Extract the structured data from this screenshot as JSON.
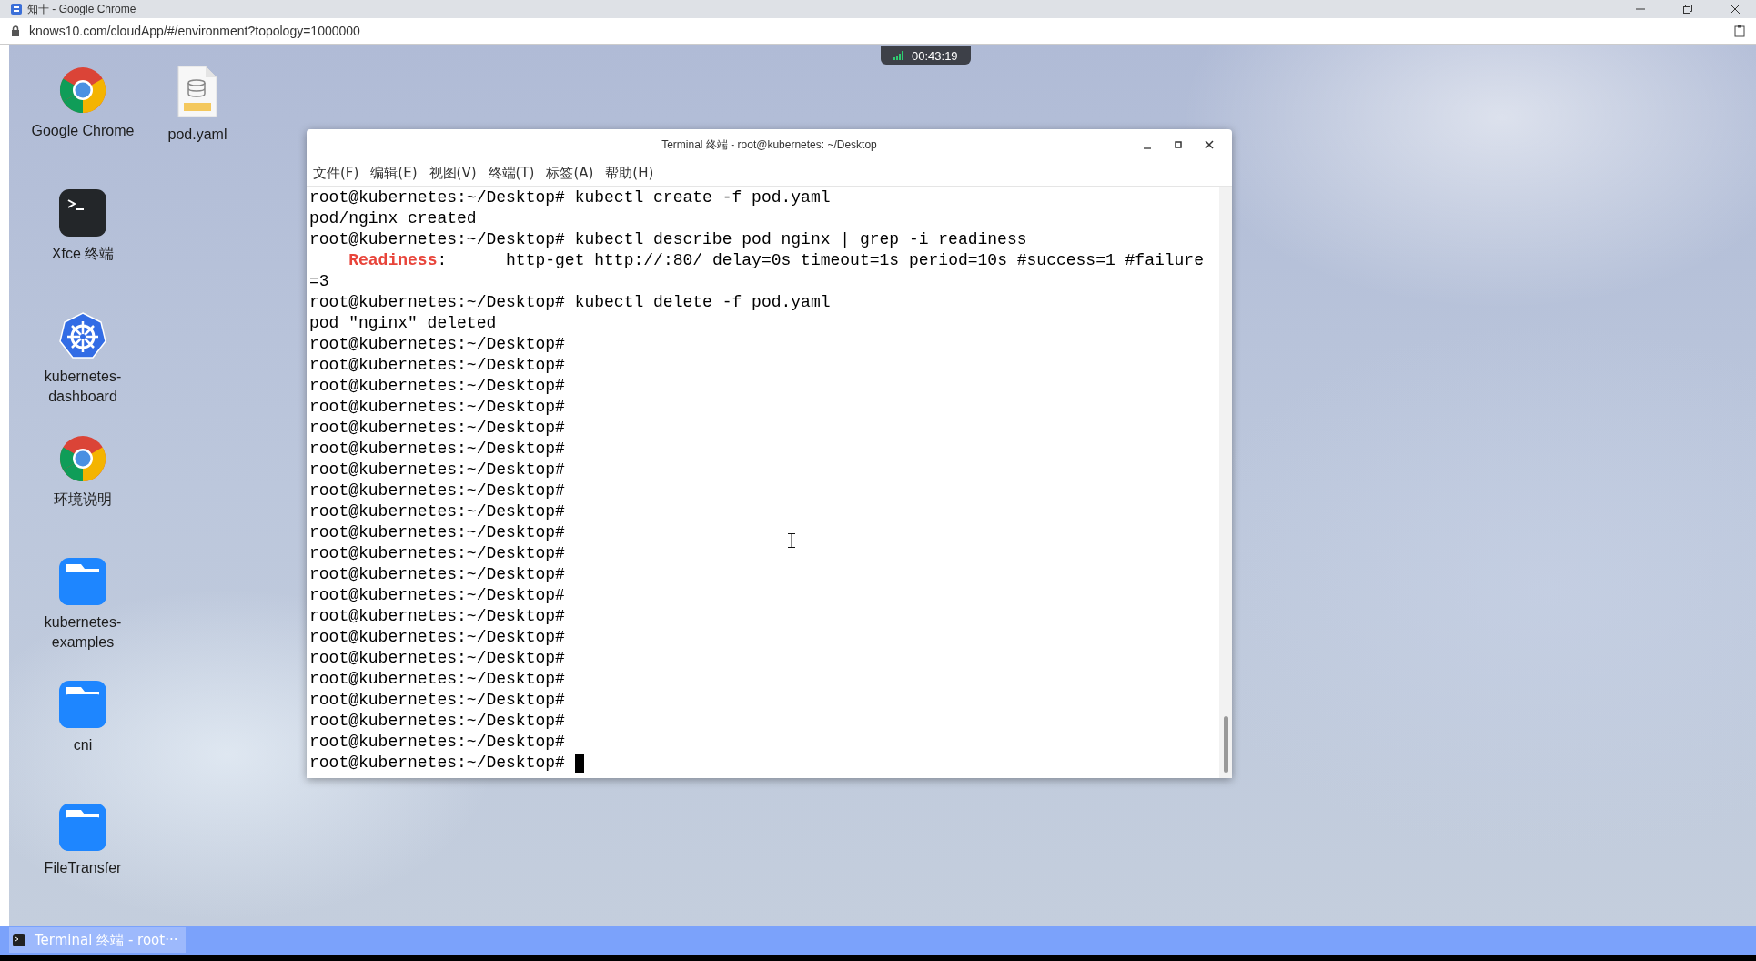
{
  "browser": {
    "title": "知十 - Google Chrome",
    "url": "knows10.com/cloudApp/#/environment?topology=1000000"
  },
  "session_timer": "00:43:19",
  "desktop_columns": [
    [
      {
        "label": "Google Chrome",
        "kind": "chrome"
      },
      {
        "label": "Xfce 终端",
        "kind": "terminal"
      },
      {
        "label": "kubernetes-dashboard",
        "kind": "kubernetes"
      },
      {
        "label": "环境说明",
        "kind": "chrome"
      },
      {
        "label": "kubernetes-examples",
        "kind": "folder"
      },
      {
        "label": "cni",
        "kind": "folder"
      },
      {
        "label": "FileTransfer",
        "kind": "folder"
      }
    ],
    [
      {
        "label": "pod.yaml",
        "kind": "yaml"
      }
    ]
  ],
  "terminal": {
    "title": "Terminal 终端 - root@kubernetes: ~/Desktop",
    "menu": [
      "文件(F)",
      "编辑(E)",
      "视图(V)",
      "终端(T)",
      "标签(A)",
      "帮助(H)"
    ],
    "lines": [
      [
        {
          "text": "root@kubernetes:~/Desktop# kubectl create -f pod.yaml"
        }
      ],
      [
        {
          "text": "pod/nginx created"
        }
      ],
      [
        {
          "text": "root@kubernetes:~/Desktop# kubectl describe pod nginx | grep -i readiness"
        }
      ],
      [
        {
          "text": "    **Readiness**:      http-get http://:80/ delay=0s timeout=1s period=10s #success=1 #failure"
        }
      ],
      [
        {
          "text": "=3"
        }
      ],
      [
        {
          "text": "root@kubernetes:~/Desktop# kubectl delete -f pod.yaml"
        }
      ],
      [
        {
          "text": "pod \"nginx\" deleted"
        }
      ],
      [
        {
          "text": "root@kubernetes:~/Desktop#"
        }
      ],
      [
        {
          "text": "root@kubernetes:~/Desktop#"
        }
      ],
      [
        {
          "text": "root@kubernetes:~/Desktop#"
        }
      ],
      [
        {
          "text": "root@kubernetes:~/Desktop#"
        }
      ],
      [
        {
          "text": "root@kubernetes:~/Desktop#"
        }
      ],
      [
        {
          "text": "root@kubernetes:~/Desktop#"
        }
      ],
      [
        {
          "text": "root@kubernetes:~/Desktop#"
        }
      ],
      [
        {
          "text": "root@kubernetes:~/Desktop#"
        }
      ],
      [
        {
          "text": "root@kubernetes:~/Desktop#"
        }
      ],
      [
        {
          "text": "root@kubernetes:~/Desktop#"
        }
      ],
      [
        {
          "text": "root@kubernetes:~/Desktop#"
        }
      ],
      [
        {
          "text": "root@kubernetes:~/Desktop#"
        }
      ],
      [
        {
          "text": "root@kubernetes:~/Desktop#"
        }
      ],
      [
        {
          "text": "root@kubernetes:~/Desktop#"
        }
      ],
      [
        {
          "text": "root@kubernetes:~/Desktop#"
        }
      ],
      [
        {
          "text": "root@kubernetes:~/Desktop#"
        }
      ],
      [
        {
          "text": "root@kubernetes:~/Desktop#"
        }
      ],
      [
        {
          "text": "root@kubernetes:~/Desktop#"
        }
      ],
      [
        {
          "text": "root@kubernetes:~/Desktop#"
        }
      ],
      [
        {
          "text": "root@kubernetes:~/Desktop#"
        }
      ],
      [
        {
          "text": "root@kubernetes:~/Desktop# "
        }
      ]
    ]
  },
  "taskbar": [
    {
      "label": "Terminal 终端 - root···",
      "selected": true
    }
  ]
}
